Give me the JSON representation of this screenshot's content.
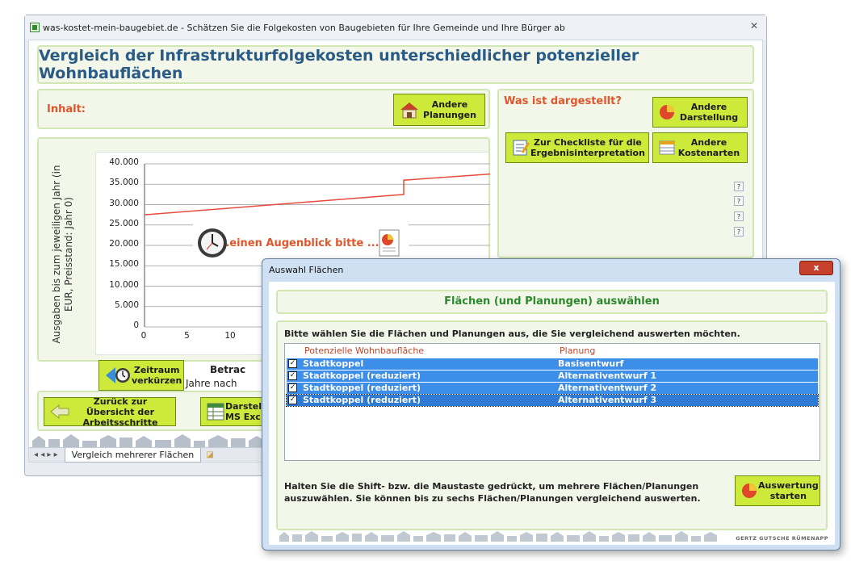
{
  "window": {
    "title": "was-kostet-mein-baugebiet.de - Schätzen Sie die Folgekosten von Baugebieten für Ihre Gemeinde und Ihre Bürger ab",
    "close_symbol": "✕"
  },
  "header": {
    "title": "Vergleich der Infrastrukturfolgekosten unterschiedlicher potenzieller Wohnbauflächen"
  },
  "left_panel": {
    "inhalt_label": "Inhalt:",
    "andere_planungen_btn": "Andere Planungen"
  },
  "right_panel": {
    "was_label": "Was ist dargestellt?",
    "andere_darstellung_btn": "Andere Darstellung",
    "checkliste_btn": "Zur Checkliste für die Ergebnisinterpretation",
    "andere_kostenarten_btn": "Andere Kostenarten",
    "help_symbol": "?"
  },
  "chart_data": {
    "type": "line",
    "ylabel": "Ausgaben bis zum jeweiligen Jahr (in EUR, Preisstand: Jahr 0)",
    "xlabel": "",
    "y_ticks": [
      "40.000",
      "35.000",
      "30.000",
      "25.000",
      "20.000",
      "15.000",
      "10.000",
      "5.000",
      "0"
    ],
    "x_ticks": [
      "0",
      "5",
      "10",
      "1"
    ],
    "ylim": [
      0,
      40000
    ],
    "grid": true,
    "series": [
      {
        "x": [
          0,
          30,
          30,
          40
        ],
        "values": [
          27500,
          32500,
          36000,
          37500
        ]
      }
    ]
  },
  "loading": {
    "text": "...einen Augenblick bitte ..."
  },
  "bottom_buttons": {
    "zeitraum_btn": "Zeitraum verkürzen",
    "betrachtung_title": "Betrac",
    "betrachtung_sub": "Jahre nach",
    "zurueck_btn": "Zurück zur Übersicht der Arbeitsschritte",
    "darstellung_btn": "Darstel MS Exc"
  },
  "sheet_tabs": {
    "nav": "◂ ◂ ▸ ▸",
    "active_tab": "Vergleich mehrerer Flächen"
  },
  "dialog": {
    "title": "Auswahl Flächen",
    "close_label": "x",
    "heading": "Flächen (und Planungen) auswählen",
    "instruction": "Bitte wählen Sie die Flächen und Planungen aus, die Sie vergleichend auswerten möchten.",
    "col1_header": "Potenzielle Wohnbaufläche",
    "col2_header": "Planung",
    "check_mark": "✓",
    "rows": [
      {
        "flaeche": "Stadtkoppel",
        "planung": "Basisentwurf"
      },
      {
        "flaeche": "Stadtkoppel (reduziert)",
        "planung": "Alternativentwurf 1"
      },
      {
        "flaeche": "Stadtkoppel (reduziert)",
        "planung": "Alternativentwurf 2"
      },
      {
        "flaeche": "Stadtkoppel (reduziert)",
        "planung": "Alternativentwurf 3"
      }
    ],
    "hint": "Halten Sie die Shift- bzw. die Maustaste gedrückt, um mehrere Flächen/Planungen auszuwählen. Sie können bis zu sechs Flächen/Planungen vergleichend auswerten.",
    "start_btn": "Auswertung starten",
    "brand": "GERTZ GUTSCHE RÜMENAPP"
  },
  "colors": {
    "accent_green": "#cde93a",
    "heading_blue": "#2a5a86",
    "label_orange": "#e0552b",
    "line_red": "#e74c3c",
    "selection_blue": "#3d8ee8"
  }
}
